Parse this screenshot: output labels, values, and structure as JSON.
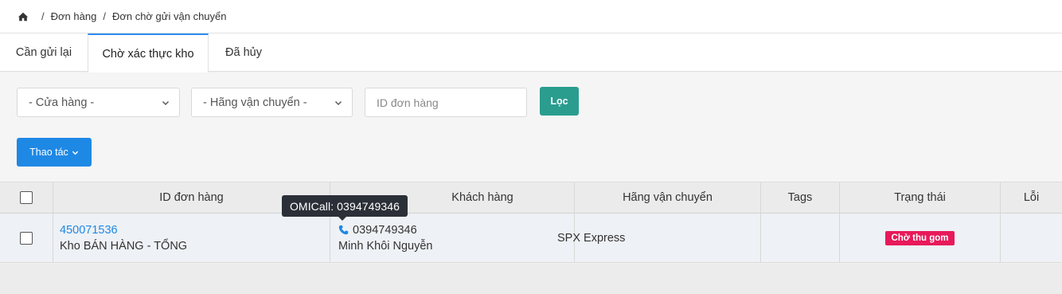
{
  "breadcrumb": {
    "home_icon": "home-icon",
    "items": [
      "Đơn hàng",
      "Đơn chờ gửi vận chuyển"
    ]
  },
  "tabs": [
    {
      "label": "Cần gửi lại",
      "active": false
    },
    {
      "label": "Chờ xác thực kho",
      "active": true
    },
    {
      "label": "Đã hủy",
      "active": false
    }
  ],
  "filters": {
    "store_select": "- Cửa hàng -",
    "carrier_select": "- Hãng vận chuyển -",
    "order_id_placeholder": "ID đơn hàng",
    "filter_button": "Lọc",
    "actions_button": "Thao tác"
  },
  "table": {
    "headers": [
      "ID đơn hàng",
      "Khách hàng",
      "Hãng vận chuyển",
      "Tags",
      "Trạng thái",
      "Lỗi"
    ],
    "rows": [
      {
        "order_id": "450071536",
        "warehouse": "Kho BÁN HÀNG - TỔNG",
        "phone": "0394749346",
        "customer_name": "Minh Khôi Nguyễn",
        "carrier": "SPX Express",
        "tags": "",
        "status": "Chờ thu gom",
        "error": ""
      }
    ]
  },
  "tooltip": "OMICall: 0394749346",
  "colors": {
    "accent_blue": "#1e88e5",
    "filter_green": "#2a9d8f",
    "status_pink": "#e8195a",
    "tooltip_bg": "#2b3038"
  }
}
